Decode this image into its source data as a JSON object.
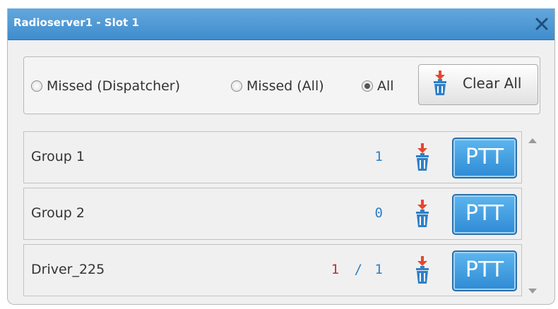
{
  "window": {
    "title": "Radioserver1 - Slot 1",
    "close_icon": "close-x-icon",
    "accent_color": "#4a97d6"
  },
  "filters": {
    "options": [
      {
        "label": "Missed (Dispatcher)",
        "selected": false
      },
      {
        "label": "Missed (All)",
        "selected": false
      },
      {
        "label": "All",
        "selected": true
      }
    ],
    "clear_all_label": "Clear All",
    "clear_icon": "trash-icon"
  },
  "rows": [
    {
      "name": "Group 1",
      "missed": "",
      "separator": "",
      "count": "1",
      "ptt_label": "PTT"
    },
    {
      "name": "Group 2",
      "missed": "",
      "separator": "",
      "count": "0",
      "ptt_label": "PTT"
    },
    {
      "name": "Driver_225",
      "missed": "1",
      "separator": "/",
      "count": "1",
      "ptt_label": "PTT"
    }
  ],
  "colors": {
    "count_blue": "#2f80c8",
    "missed_red": "#c0302a",
    "ptt_blue": "#3a92d8"
  }
}
